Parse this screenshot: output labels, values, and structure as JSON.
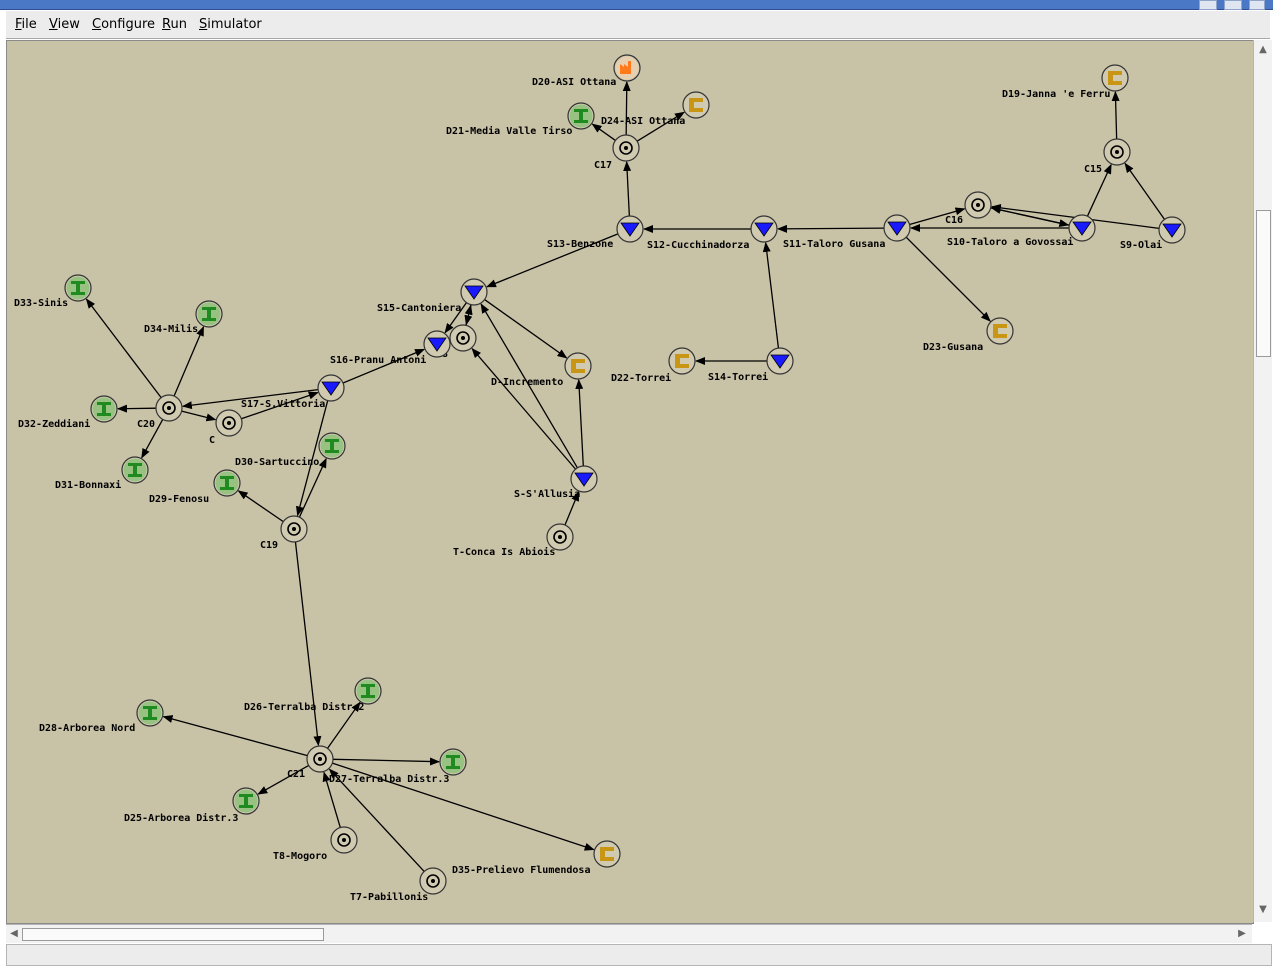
{
  "window": {
    "title": ""
  },
  "menu": [
    "File",
    "View",
    "Configure",
    "Run",
    "Simulator"
  ],
  "colors": {
    "canvas_bg": "#c8c2a7",
    "reservoir": "#1a1aff",
    "demand_icon": "#1f8a1f",
    "demand_bg": "#2db52d",
    "source_c": "#c89614",
    "industrial": "#ff7a1a"
  },
  "graph": {
    "nodes": [
      {
        "id": "D20",
        "type": "industrial",
        "label": "D20-ASI Ottana"
      },
      {
        "id": "D21",
        "type": "demand",
        "label": "D21-Media Valle Tirso"
      },
      {
        "id": "D24",
        "type": "source",
        "label": "D24-ASI Ottana"
      },
      {
        "id": "C17",
        "type": "junction",
        "label": "C17"
      },
      {
        "id": "D19",
        "type": "source",
        "label": "D19-Janna 'e Ferru"
      },
      {
        "id": "C15",
        "type": "junction",
        "label": "C15"
      },
      {
        "id": "C16",
        "type": "junction",
        "label": "C16"
      },
      {
        "id": "S10",
        "type": "reservoir",
        "label": "S10-Taloro a Govossai"
      },
      {
        "id": "S9",
        "type": "reservoir",
        "label": "S9-Olai"
      },
      {
        "id": "S11",
        "type": "reservoir",
        "label": "S11-Taloro Gusana"
      },
      {
        "id": "S12",
        "type": "reservoir",
        "label": "S12-Cucchinadorza"
      },
      {
        "id": "S13",
        "type": "reservoir",
        "label": "S13-Benzone"
      },
      {
        "id": "D23",
        "type": "source",
        "label": "D23-Gusana"
      },
      {
        "id": "S14",
        "type": "reservoir",
        "label": "S14-Torrei"
      },
      {
        "id": "D22",
        "type": "source",
        "label": "D22-Torrei"
      },
      {
        "id": "S15",
        "type": "reservoir",
        "label": "S15-Cantoniera"
      },
      {
        "id": "C18",
        "type": "junction",
        "label": "C18"
      },
      {
        "id": "S16",
        "type": "reservoir",
        "label": "S16-Pranu Antoni"
      },
      {
        "id": "DI",
        "type": "source",
        "label": "D-Incremento"
      },
      {
        "id": "SS",
        "type": "reservoir",
        "label": "S-S'Allusia"
      },
      {
        "id": "TC",
        "type": "junction",
        "label": "T-Conca Is Abiois"
      },
      {
        "id": "S17",
        "type": "reservoir",
        "label": "S17-S.Vittoria"
      },
      {
        "id": "C",
        "type": "junction",
        "label": "C"
      },
      {
        "id": "C20",
        "type": "junction",
        "label": "C20"
      },
      {
        "id": "D33",
        "type": "demand",
        "label": "D33-Sinis"
      },
      {
        "id": "D34",
        "type": "demand",
        "label": "D34-Milis"
      },
      {
        "id": "D32",
        "type": "demand",
        "label": "D32-Zeddiani"
      },
      {
        "id": "D31",
        "type": "demand",
        "label": "D31-Bonnaxi"
      },
      {
        "id": "D30",
        "type": "demand",
        "label": "D30-Sartuccino"
      },
      {
        "id": "D29",
        "type": "demand",
        "label": "D29-Fenosu"
      },
      {
        "id": "C19",
        "type": "junction",
        "label": "C19"
      },
      {
        "id": "C21",
        "type": "junction",
        "label": "C21"
      },
      {
        "id": "D26",
        "type": "demand",
        "label": "D26-Terralba Distr.2"
      },
      {
        "id": "D28",
        "type": "demand",
        "label": "D28-Arborea Nord"
      },
      {
        "id": "D27",
        "type": "demand",
        "label": "D27-Terralba Distr.3"
      },
      {
        "id": "D25",
        "type": "demand",
        "label": "D25-Arborea Distr.3"
      },
      {
        "id": "T8",
        "type": "junction",
        "label": "T8-Mogoro"
      },
      {
        "id": "T7",
        "type": "junction",
        "label": "T7-Pabillonis"
      },
      {
        "id": "D35",
        "type": "source",
        "label": "D35-Prelievo Flumendosa"
      }
    ],
    "edges": [
      [
        "C17",
        "D20"
      ],
      [
        "C17",
        "D21"
      ],
      [
        "C17",
        "D24"
      ],
      [
        "S13",
        "C17"
      ],
      [
        "C15",
        "D19"
      ],
      [
        "S10",
        "C15"
      ],
      [
        "S9",
        "C15"
      ],
      [
        "S9",
        "C16"
      ],
      [
        "S10",
        "C16"
      ],
      [
        "C16",
        "S10"
      ],
      [
        "S11",
        "C16"
      ],
      [
        "S11",
        "S12"
      ],
      [
        "S12",
        "S13"
      ],
      [
        "S11",
        "D23"
      ],
      [
        "S10",
        "S11"
      ],
      [
        "S14",
        "S12"
      ],
      [
        "S14",
        "D22"
      ],
      [
        "S13",
        "S15"
      ],
      [
        "S15",
        "S16"
      ],
      [
        "S15",
        "DI"
      ],
      [
        "C18",
        "S15"
      ],
      [
        "S15",
        "C18"
      ],
      [
        "SS",
        "S15"
      ],
      [
        "SS",
        "C18"
      ],
      [
        "SS",
        "DI"
      ],
      [
        "TC",
        "SS"
      ],
      [
        "C18",
        "S16"
      ],
      [
        "S17",
        "S16"
      ],
      [
        "S17",
        "C20"
      ],
      [
        "C",
        "S17"
      ],
      [
        "C20",
        "C"
      ],
      [
        "C20",
        "D33"
      ],
      [
        "C20",
        "D34"
      ],
      [
        "C20",
        "D32"
      ],
      [
        "C20",
        "D31"
      ],
      [
        "S17",
        "C19"
      ],
      [
        "C19",
        "D30"
      ],
      [
        "C19",
        "D29"
      ],
      [
        "C19",
        "C21"
      ],
      [
        "C21",
        "D26"
      ],
      [
        "C21",
        "D28"
      ],
      [
        "C21",
        "D27"
      ],
      [
        "C21",
        "D25"
      ],
      [
        "C21",
        "D35"
      ],
      [
        "T8",
        "C21"
      ],
      [
        "T7",
        "C21"
      ]
    ]
  }
}
